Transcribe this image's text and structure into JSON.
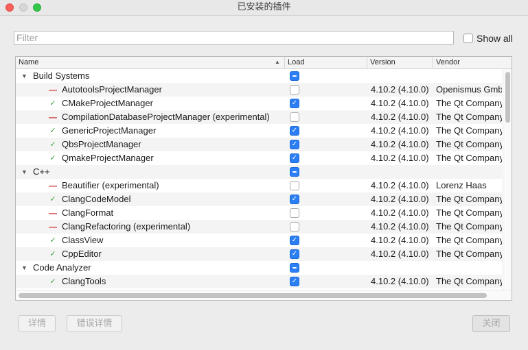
{
  "window": {
    "title": "已安装的插件"
  },
  "filter": {
    "placeholder": "Filter",
    "value": ""
  },
  "show_all": {
    "label": "Show all",
    "checked": false
  },
  "columns": {
    "name": "Name",
    "load": "Load",
    "version": "Version",
    "vendor": "Vendor"
  },
  "rows": [
    {
      "type": "category",
      "name": "Build Systems",
      "load": "partial"
    },
    {
      "type": "plugin",
      "status": "disabled",
      "name": "AutotoolsProjectManager",
      "load": "unchecked",
      "version": "4.10.2 (4.10.0)",
      "vendor": "Openismus GmbH"
    },
    {
      "type": "plugin",
      "status": "ok",
      "name": "CMakeProjectManager",
      "load": "checked",
      "version": "4.10.2 (4.10.0)",
      "vendor": "The Qt Company"
    },
    {
      "type": "plugin",
      "status": "disabled",
      "name": "CompilationDatabaseProjectManager (experimental)",
      "load": "unchecked",
      "version": "4.10.2 (4.10.0)",
      "vendor": "The Qt Company"
    },
    {
      "type": "plugin",
      "status": "ok",
      "name": "GenericProjectManager",
      "load": "checked",
      "version": "4.10.2 (4.10.0)",
      "vendor": "The Qt Company"
    },
    {
      "type": "plugin",
      "status": "ok",
      "name": "QbsProjectManager",
      "load": "checked",
      "version": "4.10.2 (4.10.0)",
      "vendor": "The Qt Company"
    },
    {
      "type": "plugin",
      "status": "ok",
      "name": "QmakeProjectManager",
      "load": "checked",
      "version": "4.10.2 (4.10.0)",
      "vendor": "The Qt Company"
    },
    {
      "type": "category",
      "name": "C++",
      "load": "partial"
    },
    {
      "type": "plugin",
      "status": "disabled",
      "name": "Beautifier (experimental)",
      "load": "unchecked",
      "version": "4.10.2 (4.10.0)",
      "vendor": "Lorenz Haas"
    },
    {
      "type": "plugin",
      "status": "ok",
      "name": "ClangCodeModel",
      "load": "checked",
      "version": "4.10.2 (4.10.0)",
      "vendor": "The Qt Company"
    },
    {
      "type": "plugin",
      "status": "disabled",
      "name": "ClangFormat",
      "load": "unchecked",
      "version": "4.10.2 (4.10.0)",
      "vendor": "The Qt Company"
    },
    {
      "type": "plugin",
      "status": "disabled",
      "name": "ClangRefactoring (experimental)",
      "load": "unchecked",
      "version": "4.10.2 (4.10.0)",
      "vendor": "The Qt Company"
    },
    {
      "type": "plugin",
      "status": "ok",
      "name": "ClassView",
      "load": "checked",
      "version": "4.10.2 (4.10.0)",
      "vendor": "The Qt Company"
    },
    {
      "type": "plugin",
      "status": "ok",
      "name": "CppEditor",
      "load": "checked",
      "version": "4.10.2 (4.10.0)",
      "vendor": "The Qt Company"
    },
    {
      "type": "category",
      "name": "Code Analyzer",
      "load": "partial"
    },
    {
      "type": "plugin",
      "status": "ok",
      "name": "ClangTools",
      "load": "checked",
      "version": "4.10.2 (4.10.0)",
      "vendor": "The Qt Company"
    }
  ],
  "buttons": {
    "details": "详情",
    "error_details": "错误详情",
    "close": "关闭"
  },
  "colors": {
    "ok_mark": "#3aa13a",
    "disabled_mark": "#d0302b",
    "checkbox_accent": "#2b7ef3"
  }
}
